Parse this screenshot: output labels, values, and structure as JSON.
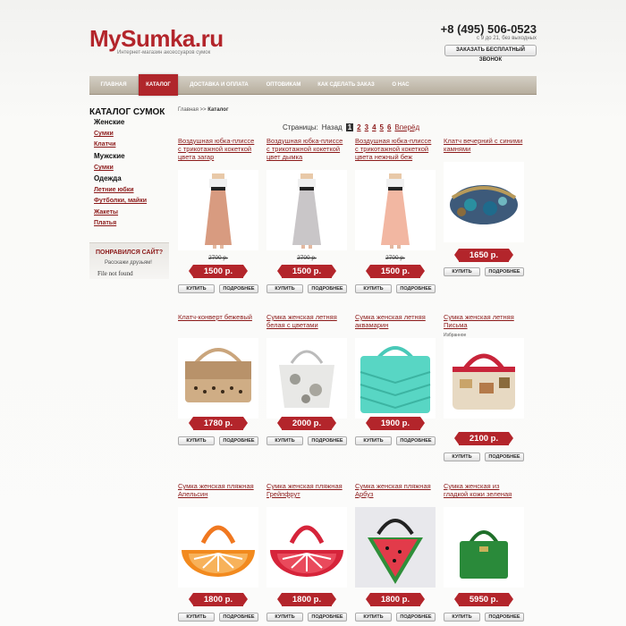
{
  "header": {
    "logo": "MySumka.ru",
    "tagline": "Интернет-магазин аксессуаров сумок",
    "phone": "+8 (495) 506-0523",
    "hours": "с 9 до 21, без выходных",
    "call_button": "ЗАКАЗАТЬ БЕСПЛАТНЫЙ ЗВОНОК"
  },
  "nav": [
    "ГЛАВНАЯ",
    "КАТАЛОГ",
    "ДОСТАВКА И ОПЛАТА",
    "ОПТОВИКАМ",
    "КАК СДЕЛАТЬ ЗАКАЗ",
    "О НАС"
  ],
  "sidebar": {
    "title": "КАТАЛОГ СУМОК",
    "items": [
      "Женские",
      "Сумки",
      "Клатчи",
      "Мужские",
      "Сумки",
      "Одежда",
      "Летние юбки",
      "Футболки, майки",
      "Жакеты",
      "Платья"
    ]
  },
  "promo": {
    "title": "ПОНРАВИЛСЯ САЙТ?",
    "subtitle": "Расскажи друзьям!",
    "error": "File not found"
  },
  "breadcrumb": {
    "home": "Главная",
    "sep": ">>",
    "current": "Каталог"
  },
  "pager": {
    "label": "Страницы:",
    "prev": "Назад",
    "pages": [
      "1",
      "2",
      "3",
      "4",
      "5",
      "6"
    ],
    "next": "Вперёд"
  },
  "buttons": {
    "buy": "КУПИТЬ",
    "more": "ПОДРОБНЕЕ"
  },
  "products": [
    {
      "title": "Воздушная юбка-плиссе с трикотажной кокеткой цвета загар",
      "old_price": "2700 р.",
      "price": "1500 р.",
      "icon": "skirt-tan-image"
    },
    {
      "title": "Воздушная юбка-плиссе с трикотажной кокеткой цвет дымка",
      "old_price": "2700 р.",
      "price": "1500 р.",
      "icon": "skirt-grey-image"
    },
    {
      "title": "Воздушная юбка-плиссе с трикотажной кокеткой цвета нежный беж",
      "old_price": "2700 р.",
      "price": "1500 р.",
      "icon": "skirt-peach-image"
    },
    {
      "title": "Клатч вечерний с синими камнями",
      "old_price": "",
      "price": "1650 р.",
      "icon": "clutch-blue-image"
    },
    {
      "title": "Клатч-конверт бежевый",
      "old_price": "",
      "price": "1780 р.",
      "icon": "clutch-beige-image"
    },
    {
      "title": "Сумка женская летняя белая с цветами",
      "old_price": "",
      "price": "2000 р.",
      "icon": "bag-white-flowers-image"
    },
    {
      "title": "Сумка женская летняя аквамарин",
      "old_price": "",
      "price": "1900 р.",
      "icon": "bag-aqua-image"
    },
    {
      "title": "Сумка женская летняя Письма",
      "note": "Избранное",
      "old_price": "",
      "price": "2100 р.",
      "icon": "bag-letters-image"
    },
    {
      "title": "Сумка женская пляжная Апельсин",
      "old_price": "",
      "price": "1800 р.",
      "icon": "bag-orange-image"
    },
    {
      "title": "Сумка женская пляжная Грейпфрут",
      "old_price": "",
      "price": "1800 р.",
      "icon": "bag-grapefruit-image"
    },
    {
      "title": "Сумка женская пляжная Арбуз",
      "old_price": "",
      "price": "1800 р.",
      "icon": "bag-watermelon-image"
    },
    {
      "title": "Сумка женская из гладкой кожи зеленая",
      "old_price": "",
      "price": "5950 р.",
      "icon": "bag-green-image"
    }
  ]
}
